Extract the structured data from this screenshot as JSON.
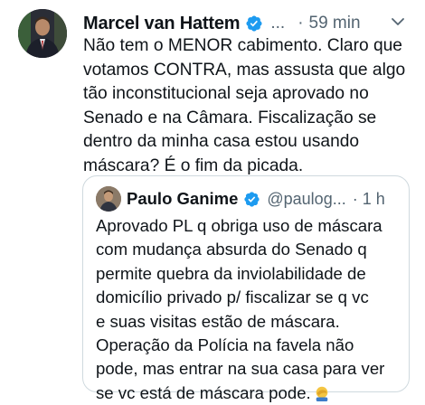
{
  "tweet": {
    "author_name": "Marcel van Hattem",
    "handle": "...",
    "separator": "·",
    "time": "59 min",
    "text": "Não tem o MENOR cabimento. Claro que\nvotamos CONTRA, mas assusta que algo\ntão inconstitucional seja aprovado no\nSenado e na Câmara. Fiscalização se\ndentro da minha casa estou usando\nmáscara? É o fim da picada.",
    "icons": {
      "verified": "verified-badge-icon",
      "menu": "chevron-down-icon"
    }
  },
  "quoted_tweet": {
    "author_name": "Paulo Ganime",
    "handle": "@paulog...",
    "separator": "·",
    "time": "1 h",
    "text": "Aprovado PL q obriga uso de máscara\ncom mudança absurda do Senado q\npermite quebra da inviolabilidade de\ndomicílio privado p/ fiscalizar se q vc\ne suas visitas estão de máscara.\nOperação da Polícia na favela não\npode, mas entrar na sua casa para ver\nse vc está de máscara pode.",
    "emoji": "facepalm-emoji"
  },
  "colors": {
    "verified_blue": "#1d9bf0",
    "secondary_text": "#536471",
    "border": "#cfd9de"
  }
}
